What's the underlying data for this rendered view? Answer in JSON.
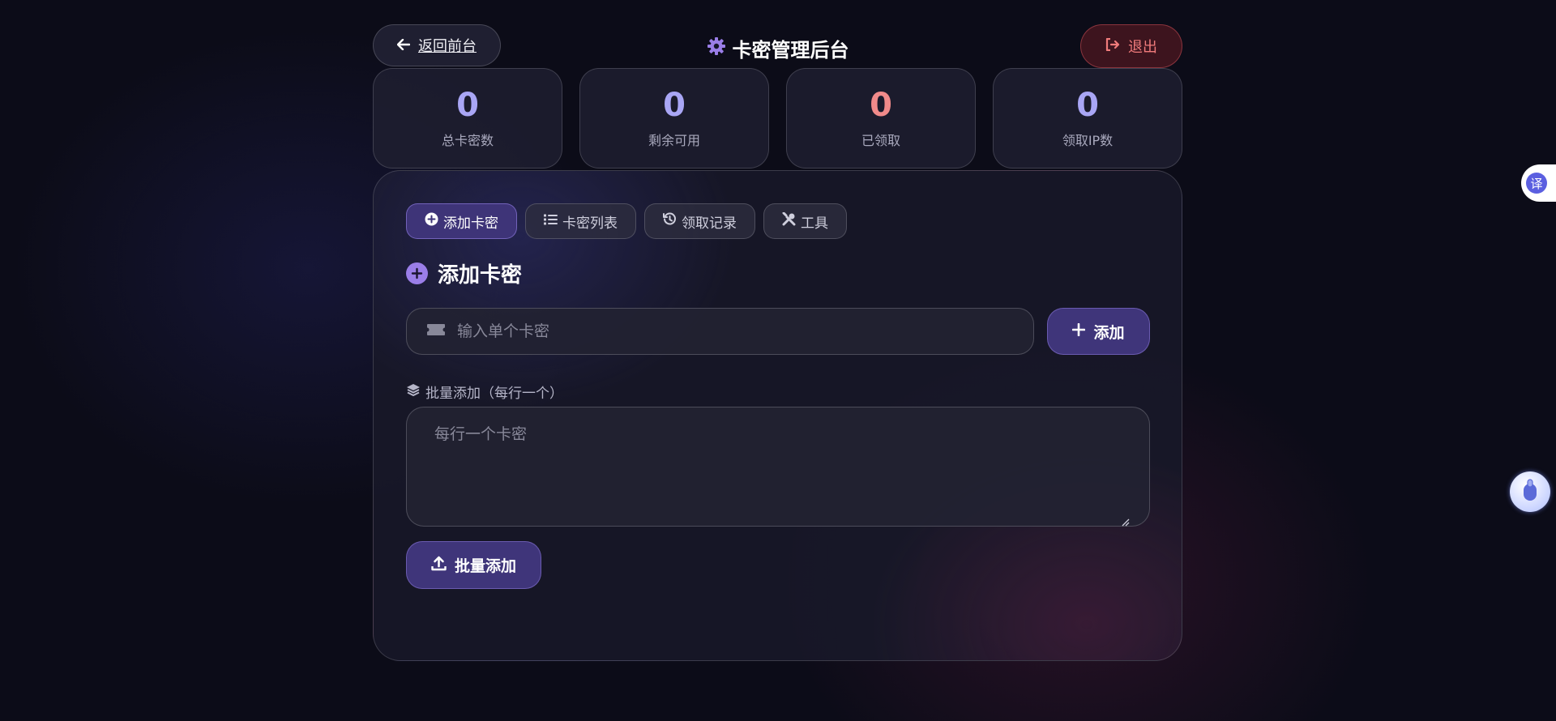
{
  "header": {
    "back_label": "返回前台",
    "title": "卡密管理后台",
    "logout_label": "退出"
  },
  "stats": [
    {
      "value": "0",
      "label": "总卡密数",
      "color": "#a9a6f5"
    },
    {
      "value": "0",
      "label": "剩余可用",
      "color": "#a9a6f5"
    },
    {
      "value": "0",
      "label": "已领取",
      "color": "#f08a8a"
    },
    {
      "value": "0",
      "label": "领取IP数",
      "color": "#a9a6f5"
    }
  ],
  "tabs": [
    {
      "label": "添加卡密",
      "icon": "plus-circle-icon",
      "active": true
    },
    {
      "label": "卡密列表",
      "icon": "list-icon",
      "active": false
    },
    {
      "label": "领取记录",
      "icon": "history-icon",
      "active": false
    },
    {
      "label": "工具",
      "icon": "tools-icon",
      "active": false
    }
  ],
  "section": {
    "title": "添加卡密"
  },
  "single": {
    "placeholder": "输入单个卡密",
    "value": "",
    "add_label": "添加"
  },
  "batch": {
    "label": "批量添加（每行一个）",
    "placeholder": "每行一个卡密",
    "value": "",
    "submit_label": "批量添加"
  },
  "floating": {
    "translate_glyph": "译"
  },
  "colors": {
    "accent": "#3f357a",
    "accent_light": "#9a7ee8",
    "danger": "#f07b7b",
    "background": "#0c0c18"
  }
}
